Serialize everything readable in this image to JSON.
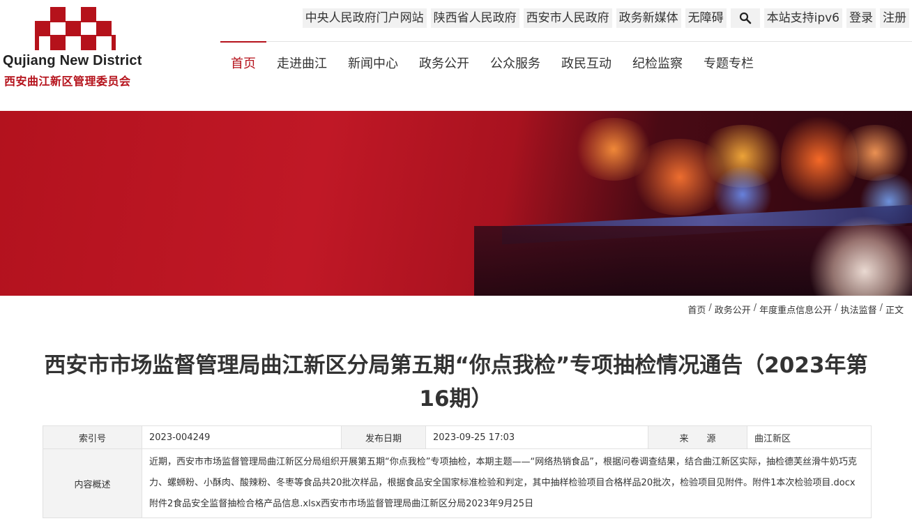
{
  "logo": {
    "en": "Qujiang New District",
    "cn": "西安曲江新区管理委员会"
  },
  "toplinks": [
    "中央人民政府门户网站",
    "陕西省人民政府",
    "西安市人民政府",
    "政务新媒体",
    "无障碍",
    "本站支持ipv6",
    "登录",
    "注册"
  ],
  "icons": {
    "search": "search-icon"
  },
  "nav": [
    "首页",
    "走进曲江",
    "新闻中心",
    "政务公开",
    "公众服务",
    "政民互动",
    "纪检监察",
    "专题专栏"
  ],
  "breadcrumb": [
    "首页",
    "政务公开",
    "年度重点信息公开",
    "执法监督",
    "正文"
  ],
  "title": "西安市市场监督管理局曲江新区分局第五期“你点我检”专项抽检情况通告（2023年第16期）",
  "meta": {
    "index_label": "索引号",
    "index_value": "2023-004249",
    "date_label": "发布日期",
    "date_value": "2023-09-25 17:03",
    "source_label": "来　　源",
    "source_value": "曲江新区",
    "summary_label": "内容概述",
    "summary_value": "近期，西安市市场监督管理局曲江新区分局组织开展第五期“你点我检”专项抽检，本期主题——“网络热销食品”，根据问卷调查结果，结合曲江新区实际，抽检德芙丝滑牛奶巧克力、螺蛳粉、小酥肉、酸辣粉、冬枣等食品共20批次样品，根据食品安全国家标准检验和判定，其中抽样检验项目合格样品20批次，检验项目见附件。附件1本次检验项目.docx附件2食品安全监督抽检合格产品信息.xlsx西安市市场监督管理局曲江新区分局2023年9月25日"
  },
  "colors": {
    "brand": "#b5121b"
  }
}
